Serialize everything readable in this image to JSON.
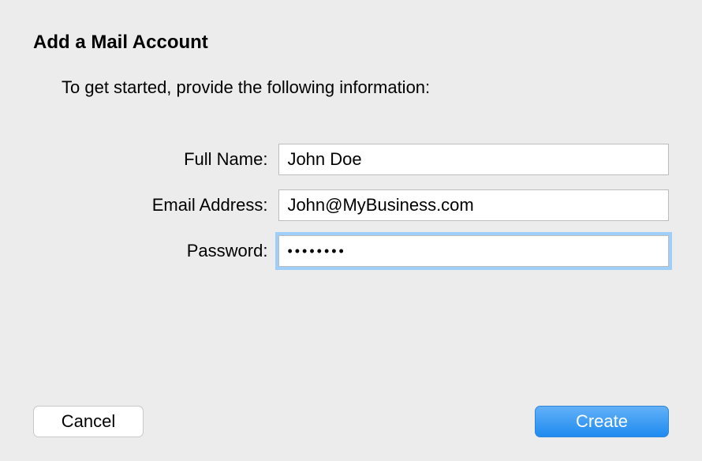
{
  "dialog": {
    "title": "Add a Mail Account",
    "subtitle": "To get started, provide the following information:"
  },
  "form": {
    "fullName": {
      "label": "Full Name:",
      "value": "John Doe"
    },
    "email": {
      "label": "Email Address:",
      "value": "John@MyBusiness.com"
    },
    "password": {
      "label": "Password:",
      "value": "••••••••"
    }
  },
  "buttons": {
    "cancel": "Cancel",
    "create": "Create"
  }
}
